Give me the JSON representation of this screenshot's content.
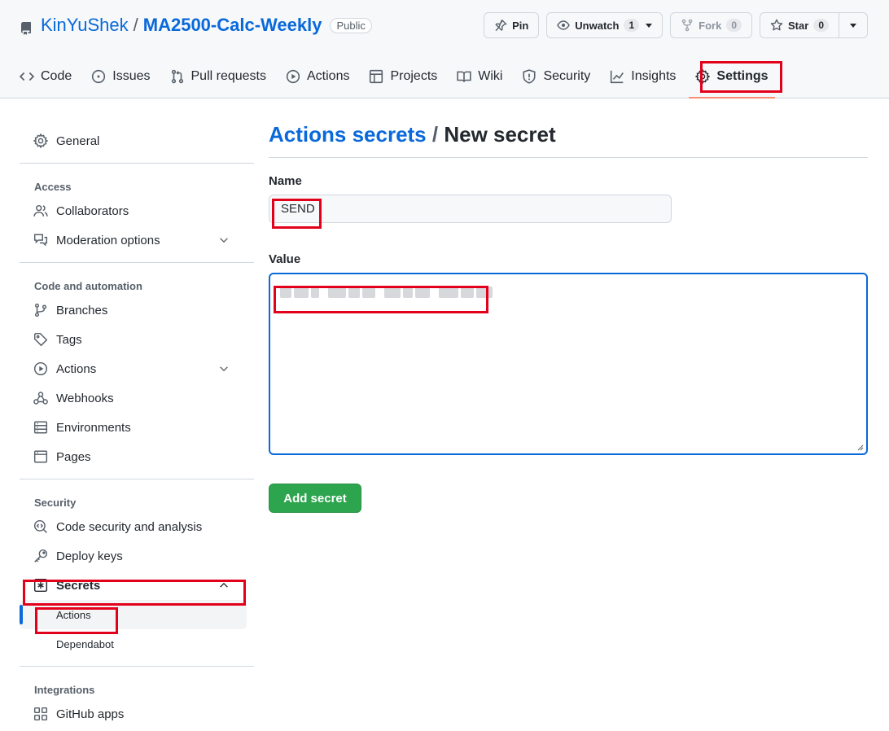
{
  "repo": {
    "owner": "KinYuShek",
    "separator": "/",
    "name": "MA2500-Calc-Weekly",
    "visibility": "Public"
  },
  "header_actions": {
    "pin_label": "Pin",
    "unwatch_label": "Unwatch",
    "unwatch_count": "1",
    "fork_label": "Fork",
    "fork_count": "0",
    "star_label": "Star",
    "star_count": "0"
  },
  "nav": {
    "tabs": [
      {
        "label": "Code",
        "icon": "code-icon"
      },
      {
        "label": "Issues",
        "icon": "issue-icon"
      },
      {
        "label": "Pull requests",
        "icon": "pull-request-icon"
      },
      {
        "label": "Actions",
        "icon": "play-icon"
      },
      {
        "label": "Projects",
        "icon": "table-icon"
      },
      {
        "label": "Wiki",
        "icon": "book-icon"
      },
      {
        "label": "Security",
        "icon": "shield-icon"
      },
      {
        "label": "Insights",
        "icon": "graph-icon"
      },
      {
        "label": "Settings",
        "icon": "gear-icon",
        "selected": true
      }
    ]
  },
  "sidebar": {
    "general": "General",
    "access_heading": "Access",
    "collaborators": "Collaborators",
    "moderation": "Moderation options",
    "code_heading": "Code and automation",
    "branches": "Branches",
    "tags": "Tags",
    "actions": "Actions",
    "webhooks": "Webhooks",
    "environments": "Environments",
    "pages": "Pages",
    "security_heading": "Security",
    "code_security": "Code security and analysis",
    "deploy_keys": "Deploy keys",
    "secrets": "Secrets",
    "secrets_actions": "Actions",
    "secrets_dependabot": "Dependabot",
    "integrations_heading": "Integrations",
    "github_apps": "GitHub apps"
  },
  "main": {
    "breadcrumb_link": "Actions secrets",
    "breadcrumb_sep": " / ",
    "breadcrumb_current": "New secret",
    "name_label": "Name",
    "name_value": "SEND",
    "value_label": "Value",
    "submit_label": "Add secret"
  },
  "colors": {
    "link": "#0969da",
    "primary_button": "#2da44e",
    "highlight_box": "#e3001b",
    "selected_underline": "#fd8c73"
  }
}
